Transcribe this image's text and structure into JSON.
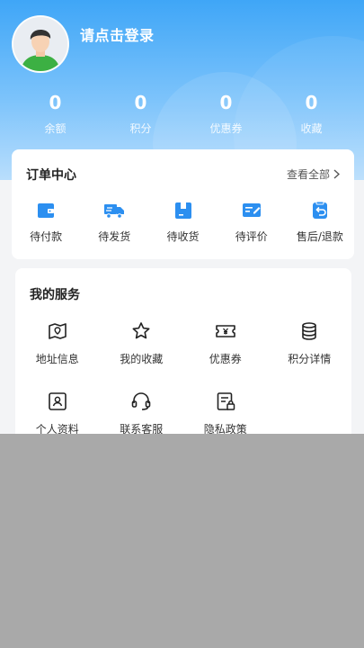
{
  "header": {
    "login_prompt": "请点击登录",
    "avatar_icon": "user-avatar"
  },
  "stats": [
    {
      "value": "0",
      "label": "余额"
    },
    {
      "value": "0",
      "label": "积分"
    },
    {
      "value": "0",
      "label": "优惠券"
    },
    {
      "value": "0",
      "label": "收藏"
    }
  ],
  "orders": {
    "title": "订单中心",
    "view_all": "查看全部",
    "items": [
      {
        "label": "待付款",
        "icon": "wallet-icon"
      },
      {
        "label": "待发货",
        "icon": "truck-icon"
      },
      {
        "label": "待收货",
        "icon": "box-icon"
      },
      {
        "label": "待评价",
        "icon": "review-icon"
      },
      {
        "label": "售后/退款",
        "icon": "refund-icon"
      }
    ]
  },
  "services": {
    "title": "我的服务",
    "items": [
      {
        "label": "地址信息",
        "icon": "map-icon"
      },
      {
        "label": "我的收藏",
        "icon": "star-icon"
      },
      {
        "label": "优惠券",
        "icon": "coupon-icon"
      },
      {
        "label": "积分详情",
        "icon": "coins-icon"
      },
      {
        "label": "个人资料",
        "icon": "profile-icon"
      },
      {
        "label": "联系客服",
        "icon": "headset-icon"
      },
      {
        "label": "隐私政策",
        "icon": "privacy-icon"
      }
    ]
  },
  "colors": {
    "accent": "#2c8ff0",
    "header_top": "#3fa6f7",
    "header_bottom": "#b9defc",
    "overlay": "#a9a9a9"
  }
}
